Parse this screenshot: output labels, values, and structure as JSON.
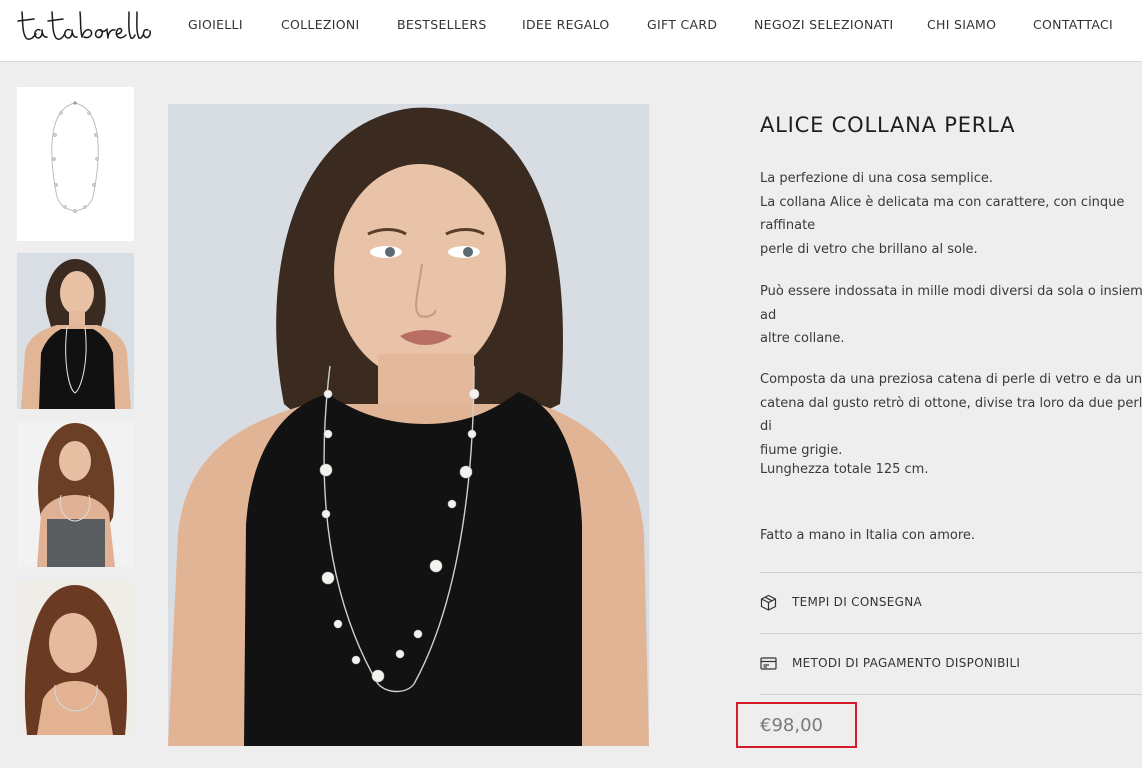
{
  "brand": {
    "logo_text": "totaborello"
  },
  "nav": {
    "items": [
      {
        "label": "GIOIELLI"
      },
      {
        "label": "COLLEZIONI"
      },
      {
        "label": "BESTSELLERS"
      },
      {
        "label": "IDEE REGALO"
      },
      {
        "label": "GIFT CARD"
      },
      {
        "label": "NEGOZI SELEZIONATI"
      },
      {
        "label": "CHI SIAMO"
      },
      {
        "label": "CONTATTACI"
      }
    ]
  },
  "gallery": {
    "thumbnails": [
      {
        "icon": "necklace-product-image"
      },
      {
        "icon": "model-portrait-image"
      },
      {
        "icon": "model-portrait-image"
      },
      {
        "icon": "model-portrait-image"
      }
    ],
    "main_image": {
      "icon": "model-wearing-necklace-image"
    }
  },
  "product": {
    "title": "ALICE COLLANA PERLA",
    "paragraphs": [
      "La perfezione di una cosa semplice.\nLa collana Alice è delicata ma con carattere, con cinque raffinate\nperle di vetro che brillano al sole.",
      "Può essere indossata in mille modi diversi da sola o insieme ad\naltre collane.",
      "Composta da una preziosa catena di perle di vetro e da una\ncatena dal gusto retrò di ottone, divise tra loro da due perle di\nfiume grigie.",
      "Lunghezza totale 125 cm.",
      "Fatto a mano in Italia con amore."
    ],
    "accordion": [
      {
        "label": "TEMPI DI CONSEGNA",
        "icon": "box-icon"
      },
      {
        "label": "METODI DI PAGAMENTO DISPONIBILI",
        "icon": "card-icon"
      }
    ],
    "price": "€98,00"
  },
  "colors": {
    "highlight": "#d51c2a",
    "background": "#eeeeee"
  }
}
